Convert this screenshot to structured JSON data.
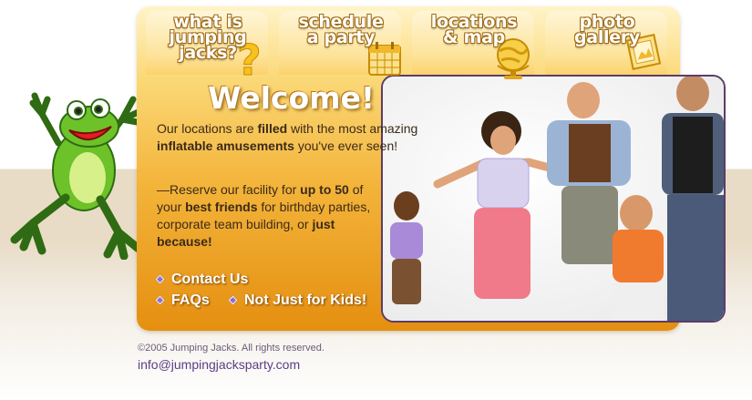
{
  "tabs": [
    {
      "label": "what is\njumping\njacks?",
      "icon": "question-mark-icon"
    },
    {
      "label": "schedule\na party",
      "icon": "calendar-icon"
    },
    {
      "label": "locations\n& map",
      "icon": "globe-icon"
    },
    {
      "label": "photo\ngallery",
      "icon": "photo-frame-icon"
    }
  ],
  "welcome": {
    "title": "Welcome!",
    "p1": {
      "a": "Our locations are ",
      "b": "filled",
      "c": " with the most amazing ",
      "d": "inflatable amusements",
      "e": " you've ever seen!"
    },
    "p2": {
      "a": "—Reserve our facility for ",
      "b": "up to 50",
      "c": " of your ",
      "d": "best friends",
      "e": " for birthday parties, corporate team building, or ",
      "f": "just because!"
    }
  },
  "links": {
    "contact": "Contact Us",
    "faqs": "FAQs",
    "kids": "Not Just for Kids!"
  },
  "footer": {
    "copyright": "©2005 Jumping Jacks. All rights reserved.",
    "email": "info@jumpingjacksparty.com"
  },
  "colors": {
    "panel_orange": "#f3b43a",
    "link_bullet": "#8a6fd6",
    "email": "#5a3e86"
  }
}
